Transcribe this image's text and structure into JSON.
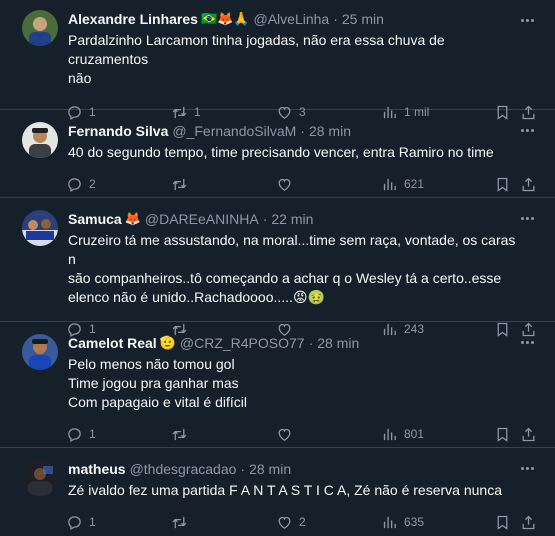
{
  "tweets": [
    {
      "name": "Alexandre Linhares",
      "emojis": "🇧🇷🦊🙏",
      "handle": "@AlveLinha",
      "time": "25 min",
      "text": "Pardalzinho Larcamon tinha jogadas, não era essa chuva de cruzamentos\nnão",
      "replies": "1",
      "retweets": "1",
      "likes": "3",
      "views": "1 mil"
    },
    {
      "name": "Fernando Silva",
      "emojis": "",
      "handle": "@_FernandoSilvaM",
      "time": "28 min",
      "text": "40 do segundo tempo, time precisando vencer, entra Ramiro no time",
      "replies": "2",
      "retweets": "",
      "likes": "",
      "views": "621"
    },
    {
      "name": "Samuca",
      "emojis": "🦊",
      "handle": "@DAREeANINHA",
      "time": "22 min",
      "text": "Cruzeiro tá me assustando, na moral...time sem raça, vontade, os caras n\nsão companheiros..tô começando a achar q o Wesley tá a certo..esse\nelenco não é unido..Rachadoooo.....😡🤢",
      "replies": "1",
      "retweets": "",
      "likes": "",
      "views": "243"
    },
    {
      "name": "Camelot Real",
      "emojis": "🫡",
      "handle": "@CRZ_R4POSO77",
      "time": "28 min",
      "text": "Pelo menos não tomou gol\nTime jogou pra ganhar mas\nCom papagaio e vital é difícil",
      "replies": "1",
      "retweets": "",
      "likes": "",
      "views": "801"
    },
    {
      "name": "matheus",
      "emojis": "",
      "handle": "@thdesgracadao",
      "time": "28 min",
      "text": "Zé ivaldo fez uma partida F A N T A S T I C A, Zé não é reserva nunca",
      "replies": "1",
      "retweets": "",
      "likes": "2",
      "views": "635"
    }
  ],
  "separator": "·",
  "colors": {
    "background": "#15202b",
    "border": "#38444d",
    "muted": "#8b98a5",
    "text": "#f7f9f9"
  },
  "icons": [
    "reply-icon",
    "retweet-icon",
    "like-icon",
    "views-icon",
    "bookmark-icon",
    "share-icon",
    "more-icon"
  ]
}
